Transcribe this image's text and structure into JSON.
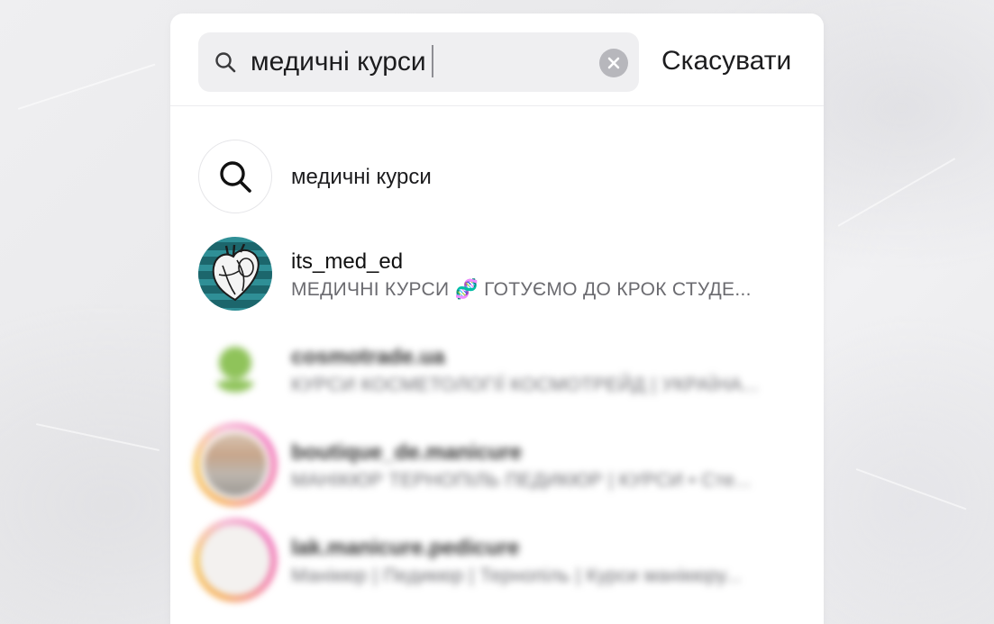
{
  "search": {
    "query": "медичні курси",
    "cancel_label": "Скасувати"
  },
  "results": [
    {
      "type": "keyword",
      "title": "медичні курси",
      "icon": "search-icon"
    },
    {
      "type": "account",
      "title": "its_med_ed",
      "subtitle": "МЕДИЧНІ КУРСИ 🧬 ГОТУЄМО ДО КРОК СТУДЕ..."
    },
    {
      "type": "account",
      "title": "cosmotrade.ua",
      "subtitle": "КУРСИ КОСМЕТОЛОГІЇ КОСМОТРЕЙД | УКРАЇНА...",
      "blurred": true
    },
    {
      "type": "account",
      "title": "boutique_de.manicure",
      "subtitle": "МАНІКЮР ТЕРНОПІЛЬ ПЕДИКЮР | КУРСИ • Сте...",
      "blurred": true
    },
    {
      "type": "account",
      "title": "lak.manicure.pedicure",
      "subtitle": "Манікюр | Педикюр | Тернопіль | Курси манікюру...",
      "blurred": true
    }
  ],
  "colors": {
    "panel": "#ffffff",
    "search_field": "#efeff1",
    "primary_text": "#111111",
    "secondary_text": "#6b6b70",
    "med_avatar": "#2f8f96",
    "cosmo_logo": "#8fc35a"
  }
}
